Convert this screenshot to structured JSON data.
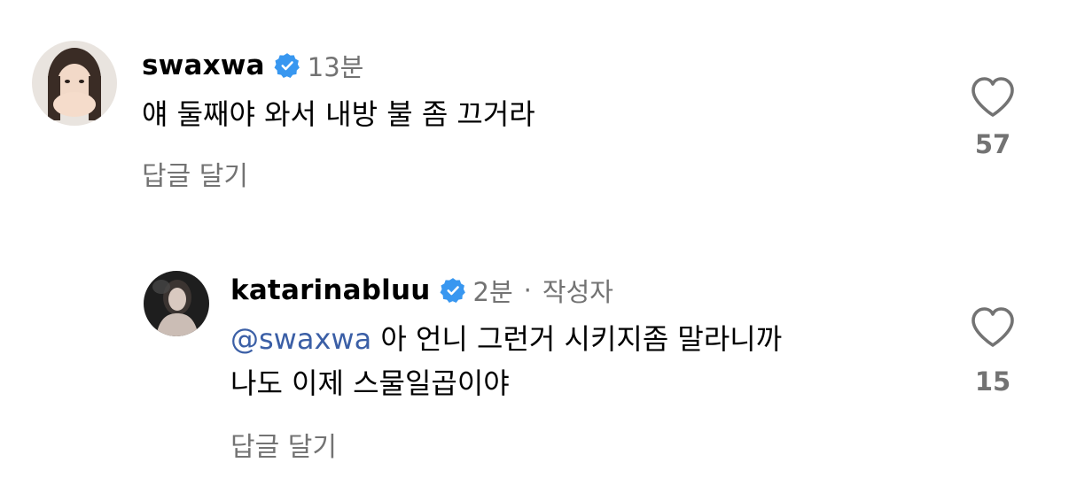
{
  "comments": [
    {
      "username": "swaxwa",
      "verified": true,
      "time": "13분",
      "text": "얘 둘째야 와서 내방 불 좀 끄거라",
      "reply_label": "답글 달기",
      "likes": "57"
    }
  ],
  "reply": {
    "username": "katarinabluu",
    "verified": true,
    "time": "2분",
    "separator": "·",
    "author_tag": "작성자",
    "mention": "@swaxwa",
    "text_line1": "아 언니 그런거 시키지좀 말라니까",
    "text_line2": "나도 이제 스물일곱이야",
    "reply_label": "답글 달기",
    "likes": "15"
  },
  "colors": {
    "verified_badge": "#3897f0",
    "muted_text": "#737373",
    "mention": "#3b5fa6"
  },
  "icons": {
    "like": "heart-outline-icon",
    "verified": "verified-badge-icon"
  }
}
